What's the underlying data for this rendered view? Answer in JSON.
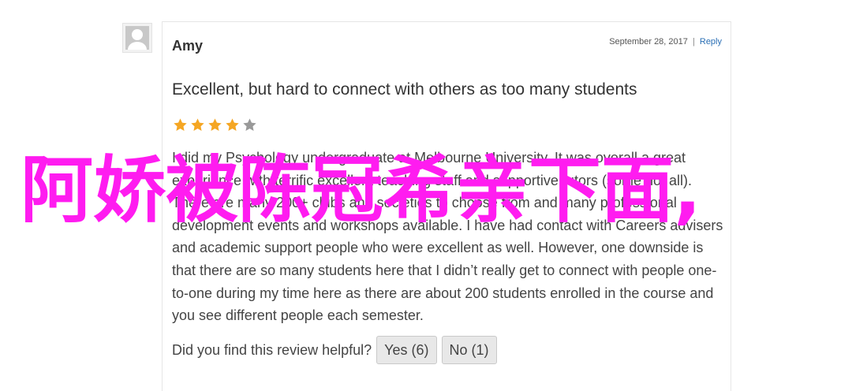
{
  "review": {
    "author": "Amy",
    "date": "September 28, 2017",
    "separator": "|",
    "reply_label": "Reply",
    "title": "Excellent, but hard to connect with others as too many students",
    "rating": 4,
    "rating_max": 5,
    "star_color_filled": "#f5a623",
    "star_color_empty": "#999999",
    "body": "I did my Psychology undergraduate at Melbourne University. It was overall a great experience with terrific excellent teaching staff and supportive tutors (some not all). There are many 200+ clubs and societies to choose from and many professional development events and workshops available. I have had contact with Careers advisers and academic support people who were excellent as well. However, one downside is that there are so many students here that I didn’t really get to connect with people one-to-one during my time here as there are about 200 students enrolled in the course and you see different people each semester.",
    "helpful_prompt": "Did you find this review helpful?",
    "yes_label": "Yes (6)",
    "no_label": "No (1)"
  },
  "overlay": {
    "text": "阿娇被陈冠希亲下面,",
    "color": "#ff1cf0"
  }
}
